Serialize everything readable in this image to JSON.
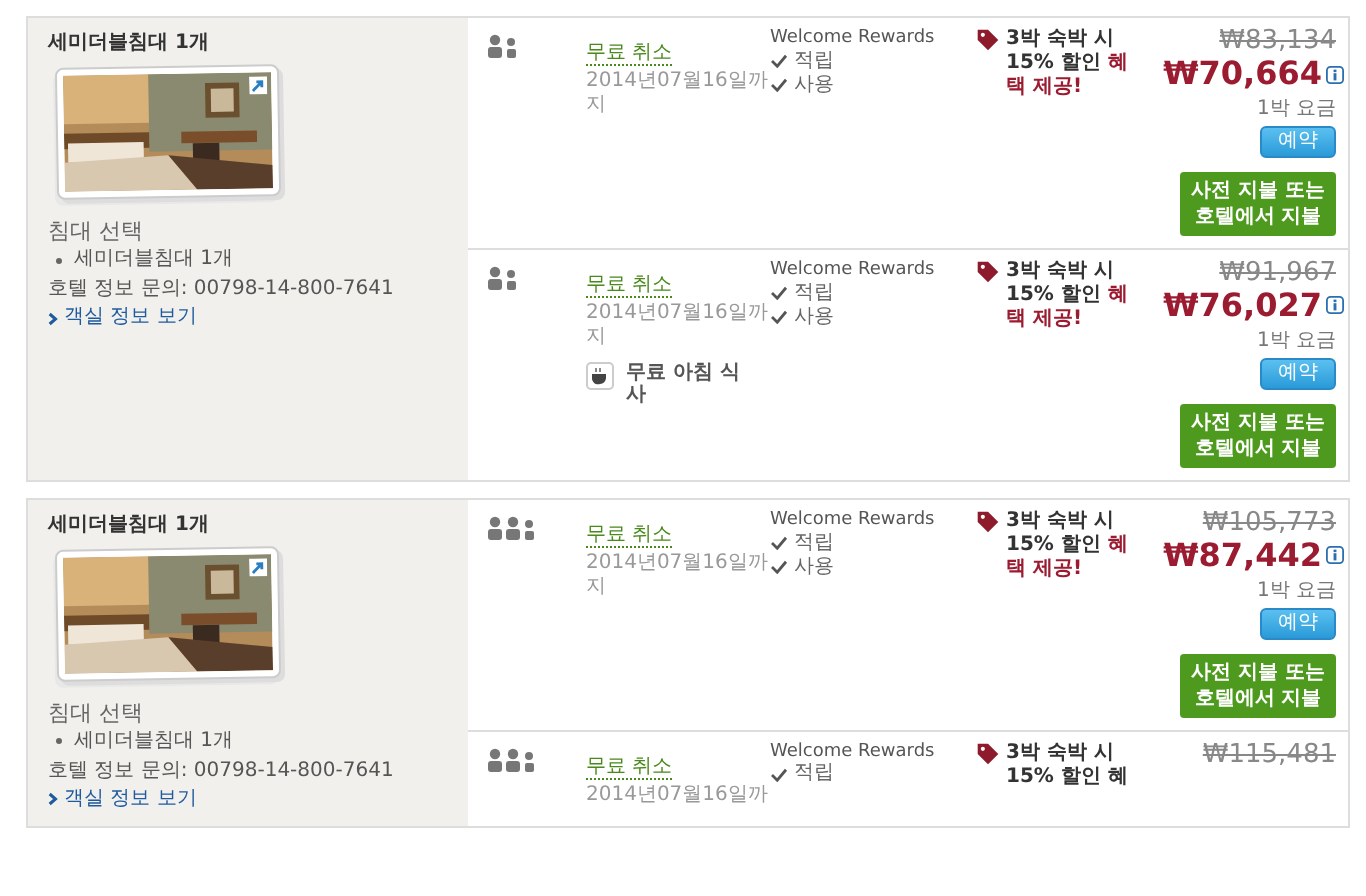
{
  "rooms": [
    {
      "title": "세미더블침대 1개",
      "picture": {
        "kind": "picture"
      },
      "bed_heading": "침대 선택",
      "beds": [
        "세미더블침대 1개"
      ],
      "contact": "호텔 정보 문의: 00798-14-800-7641",
      "link": "객실 정보 보기",
      "rates": [
        {
          "occupancy": {
            "kind": "two-people"
          },
          "cancel": "무료 취소",
          "cancel_until": "2014년07월16일까지",
          "rewards_title": "Welcome Rewards",
          "rewards": [
            "적립",
            "사용"
          ],
          "promo": "3박 숙박 시 15% 할인 **혜택 제공!**",
          "old_price": "₩83,134",
          "price": "₩70,664",
          "per_night": "1박 요금",
          "book_button": "예약",
          "payment_note": "사전 지불 또는 호텔에서 지불"
        },
        {
          "occupancy": {
            "kind": "two-people"
          },
          "cancel": "무료 취소",
          "cancel_until": "2014년07월16일까지",
          "extras": [
            "무료 아침 식사"
          ],
          "rewards_title": "Welcome Rewards",
          "rewards": [
            "적립",
            "사용"
          ],
          "promo": "3박 숙박 시 15% 할인 **혜택 제공!**",
          "old_price": "₩91,967",
          "price": "₩76,027",
          "per_night": "1박 요금",
          "book_button": "예약",
          "payment_note": "사전 지불 또는 호텔에서 지불"
        }
      ]
    },
    {
      "title": "세미더블침대 1개",
      "picture": {
        "kind": "picture"
      },
      "bed_heading": "침대 선택",
      "beds": [
        "세미더블침대 1개"
      ],
      "contact": "호텔 정보 문의: 00798-14-800-7641",
      "link": "객실 정보 보기",
      "rates": [
        {
          "occupancy": {
            "kind": "three-people"
          },
          "cancel": "무료 취소",
          "cancel_until": "2014년07월16일까지",
          "rewards_title": "Welcome Rewards",
          "rewards": [
            "적립",
            "사용"
          ],
          "promo": "3박 숙박 시 15% 할인 **혜택 제공!**",
          "old_price": "₩105,773",
          "price": "₩87,442",
          "per_night": "1박 요금",
          "book_button": "예약",
          "payment_note": "사전 지불 또는 호텔에서 지불"
        },
        {
          "occupancy": {
            "kind": "three-people"
          },
          "cancel": "무료 취소",
          "cancel_until": "2014년07월16일까",
          "rewards_title": "Welcome Rewards",
          "rewards": [
            "적립"
          ],
          "promo": "3박 숙박 시 15% 할인 혜",
          "old_price": "₩115,481"
        }
      ]
    }
  ]
}
